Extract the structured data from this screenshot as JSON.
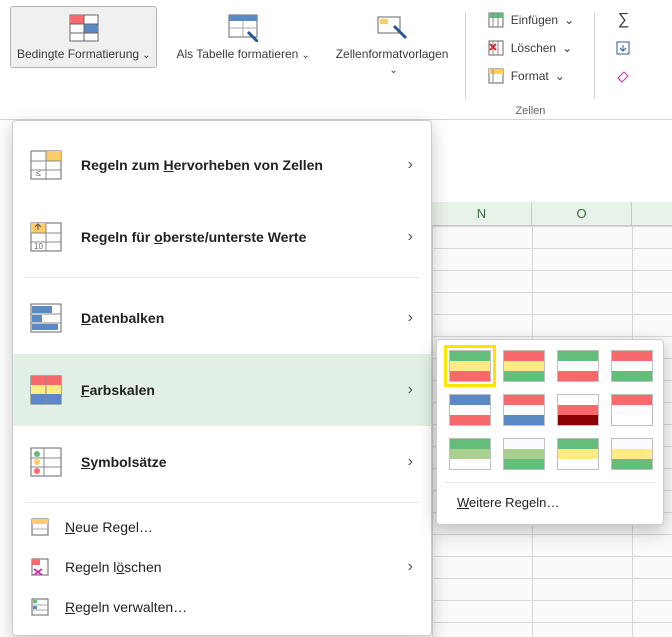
{
  "ribbon": {
    "conditional_formatting": "Bedingte\nFormatierung",
    "format_as_table": "Als Tabelle\nformatieren",
    "cell_styles": "Zellenformatvorlagen",
    "insert": "Einfügen",
    "delete": "Löschen",
    "format": "Format",
    "cells_group": "Zellen"
  },
  "menu": {
    "highlight_rules_pre": "Regeln zum ",
    "highlight_rules_u": "H",
    "highlight_rules_post": "ervorheben von Zellen",
    "top_bottom_pre": "Regeln für ",
    "top_bottom_u": "o",
    "top_bottom_post": "berste/unterste Werte",
    "data_bars_u": "D",
    "data_bars_post": "atenbalken",
    "color_scales_u": "F",
    "color_scales_post": "arbskalen",
    "icon_sets_u": "S",
    "icon_sets_post": "ymbolsätze",
    "new_rule_u": "N",
    "new_rule_post": "eue Regel…",
    "clear_rules_pre": "Regeln l",
    "clear_rules_u": "ö",
    "clear_rules_post": "schen",
    "manage_rules_u": "R",
    "manage_rules_post": "egeln verwalten…"
  },
  "submenu": {
    "more_rules_u": "W",
    "more_rules_post": "eitere Regeln…",
    "swatches": [
      [
        "#63be7b",
        "#ffeb84",
        "#f8696b"
      ],
      [
        "#f8696b",
        "#ffeb84",
        "#63be7b"
      ],
      [
        "#63be7b",
        "#fcfcff",
        "#f8696b"
      ],
      [
        "#f8696b",
        "#fcfcff",
        "#63be7b"
      ],
      [
        "#5a8ac6",
        "#fcfcff",
        "#f8696b"
      ],
      [
        "#f8696b",
        "#fcfcff",
        "#5a8ac6"
      ],
      [
        "#fcfcff",
        "#f8696b",
        "#8b0000"
      ],
      [
        "#f8696b",
        "#fcfcff",
        "#ffffff"
      ],
      [
        "#63be7b",
        "#a9d08e",
        "#fcfcff"
      ],
      [
        "#fcfcff",
        "#a9d08e",
        "#63be7b"
      ],
      [
        "#63be7b",
        "#ffeb84",
        "#fcfcff"
      ],
      [
        "#fcfcff",
        "#ffeb84",
        "#63be7b"
      ]
    ]
  },
  "columns": [
    "N",
    "O"
  ]
}
